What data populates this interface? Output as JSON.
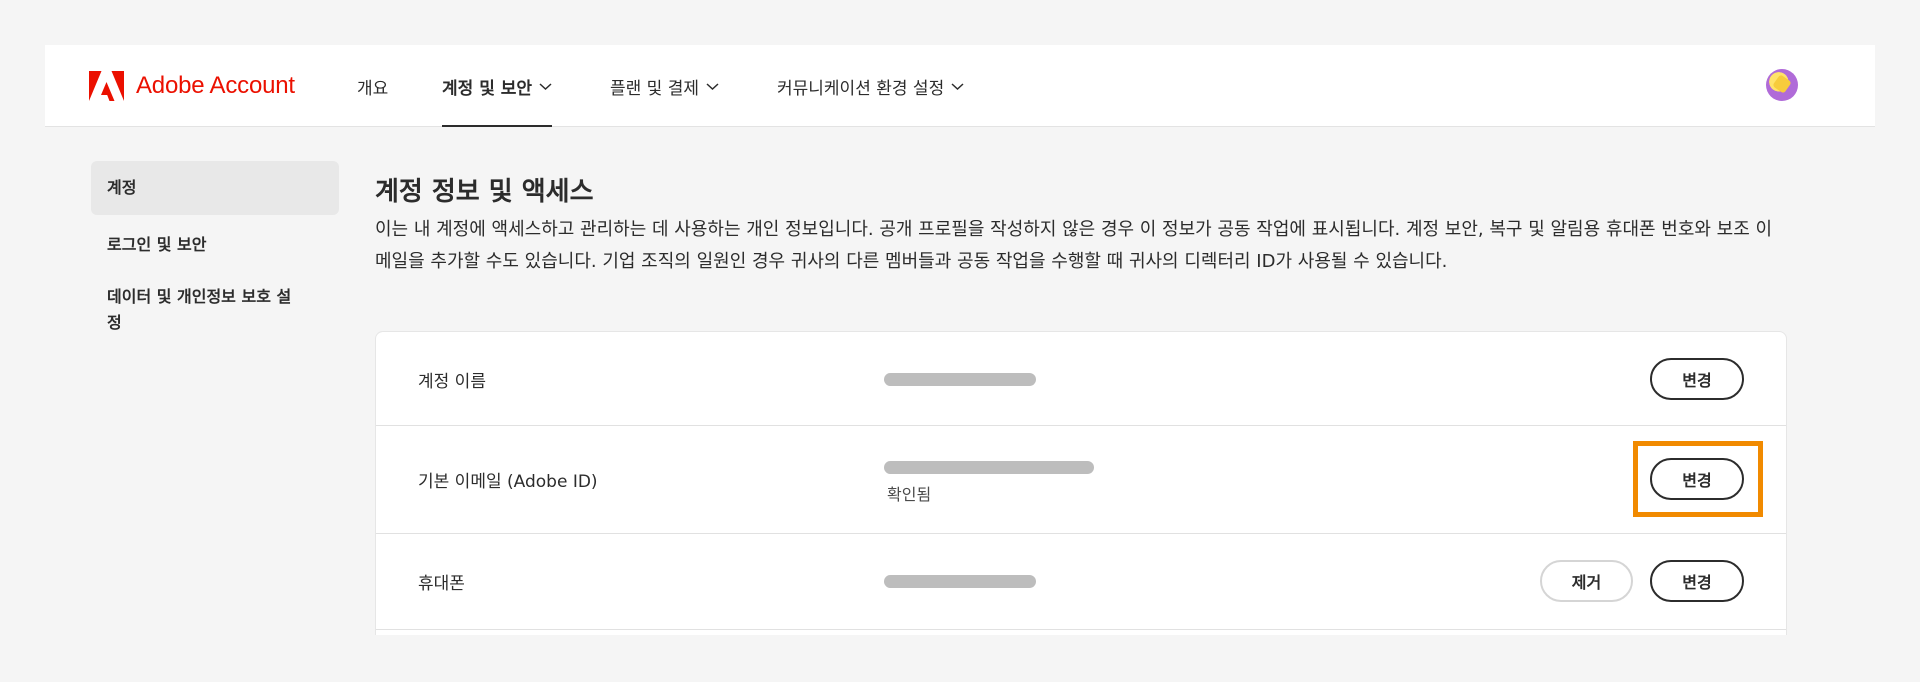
{
  "brand": {
    "name": "Adobe Account",
    "color": "#eb1000"
  },
  "nav": {
    "items": [
      {
        "label": "개요",
        "has_dropdown": false
      },
      {
        "label": "계정 및 보안",
        "has_dropdown": true,
        "active": true
      },
      {
        "label": "플랜 및 결제",
        "has_dropdown": true
      },
      {
        "label": "커뮤니케이션 환경 설정",
        "has_dropdown": true
      }
    ]
  },
  "sidebar": {
    "items": [
      {
        "label": "계정",
        "active": true
      },
      {
        "label": "로그인 및 보안"
      },
      {
        "label": "데이터 및 개인정보 보호 설정"
      }
    ]
  },
  "main": {
    "title": "계정 정보 및 액세스",
    "description": "이는 내 계정에 액세스하고 관리하는 데 사용하는 개인 정보입니다. 공개 프로필을 작성하지 않은 경우 이 정보가 공동 작업에 표시됩니다. 계정 보안, 복구 및 알림용 휴대폰 번호와 보조 이메일을 추가할 수도 있습니다. 기업 조직의 일원인 경우 귀사의 다른 멤버들과 공동 작업을 수행할 때 귀사의 디렉터리 ID가 사용될 수 있습니다."
  },
  "rows": [
    {
      "label": "계정 이름",
      "value_redacted": true,
      "actions": [
        "변경"
      ]
    },
    {
      "label": "기본 이메일 (Adobe ID)",
      "value_redacted": true,
      "status": "확인됨",
      "actions": [
        "변경"
      ],
      "highlighted_action": "변경"
    },
    {
      "label": "휴대폰",
      "value_redacted": true,
      "actions": [
        "제거",
        "변경"
      ]
    }
  ],
  "colors": {
    "highlight": "#f18a00",
    "redaction": "#bdbdbd"
  }
}
